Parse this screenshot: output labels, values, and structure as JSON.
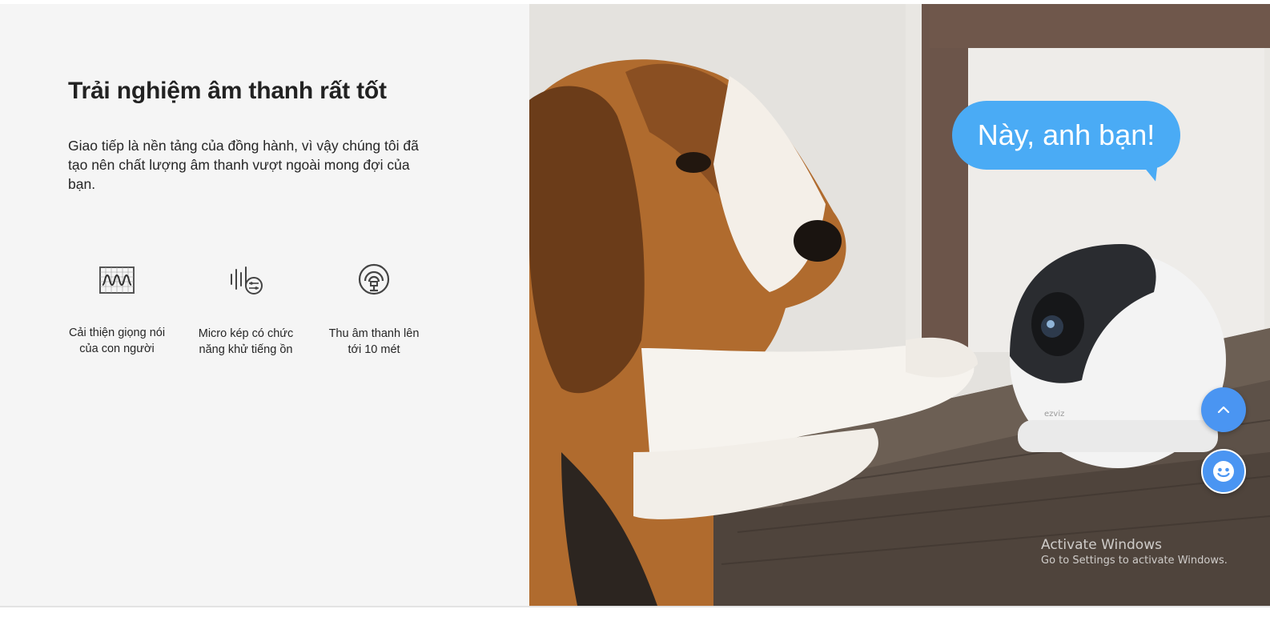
{
  "section": {
    "heading": "Trải nghiệm âm thanh rất tốt",
    "description": "Giao tiếp là nền tảng của đồng hành, vì vậy chúng tôi đã tạo nên chất lượng âm thanh vượt ngoài mong đợi của bạn.",
    "features": [
      {
        "icon": "voice-waveform-icon",
        "label": "Cải thiện giọng nói của con người"
      },
      {
        "icon": "dual-microphone-noise-cancel-icon",
        "label": "Micro kép có chức năng khử tiếng ồn"
      },
      {
        "icon": "sound-pickup-range-icon",
        "label": "Thu âm thanh lên tới 10 mét"
      }
    ]
  },
  "hero": {
    "speech_bubble": "Này, anh bạn!",
    "camera_brand": "ezviz"
  },
  "floating_buttons": {
    "scroll_top_icon": "chevron-up-icon",
    "chat_icon": "smiley-chat-icon"
  },
  "os_watermark": {
    "title": "Activate Windows",
    "subtitle": "Go to Settings to activate Windows."
  },
  "colors": {
    "left_background": "#f5f5f5",
    "accent_blue": "#4aabf5",
    "fab_blue": "#4a95f2",
    "text_dark": "#222222"
  }
}
